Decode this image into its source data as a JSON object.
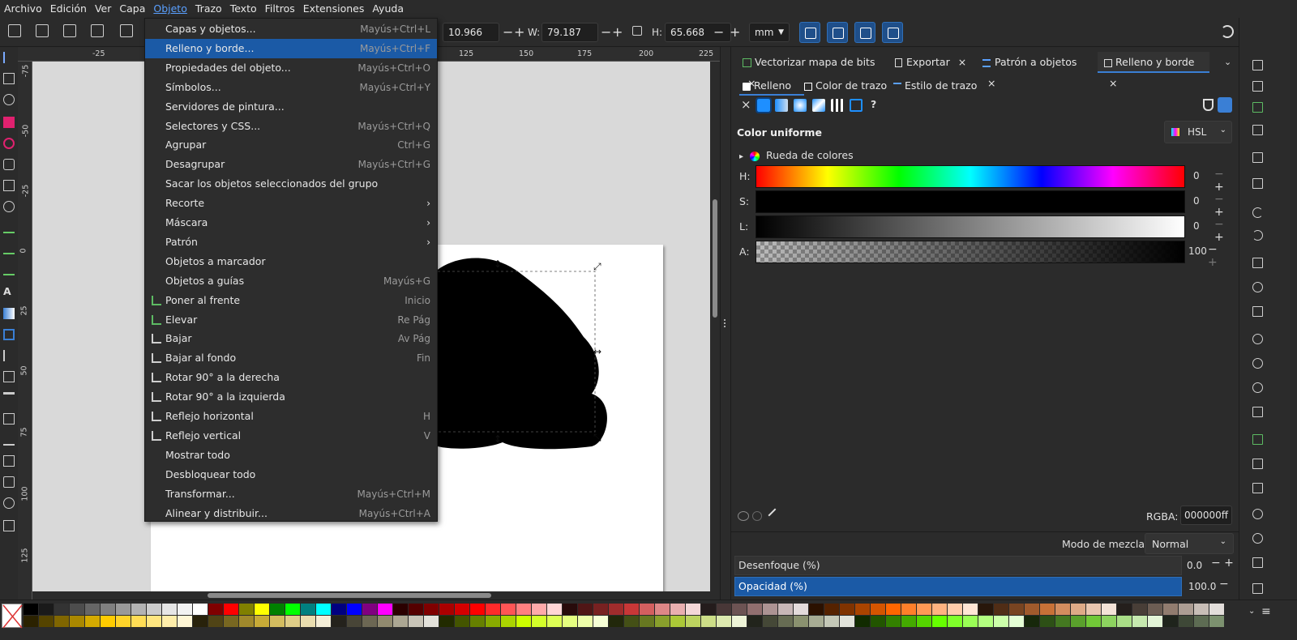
{
  "menubar": {
    "items": [
      "Archivo",
      "Edición",
      "Ver",
      "Capa",
      "Objeto",
      "Trazo",
      "Texto",
      "Filtros",
      "Extensiones",
      "Ayuda"
    ],
    "active": "Objeto"
  },
  "toolbar": {
    "x_value": "10.966",
    "w_label": "W:",
    "w_value": "79.187",
    "h_label": "H:",
    "h_value": "65.668",
    "unit": "mm",
    "plus": "+",
    "minus": "−"
  },
  "object_menu": {
    "items": [
      {
        "label": "Capas y objetos...",
        "shortcut": "Mayús+Ctrl+L"
      },
      {
        "label": "Relleno y borde...",
        "shortcut": "Mayús+Ctrl+F",
        "highlighted": true
      },
      {
        "label": "Propiedades del objeto...",
        "shortcut": "Mayús+Ctrl+O"
      },
      {
        "label": "Símbolos...",
        "shortcut": "Mayús+Ctrl+Y"
      },
      {
        "label": "Servidores de pintura...",
        "shortcut": ""
      },
      {
        "label": "Selectores y CSS...",
        "shortcut": "Mayús+Ctrl+Q"
      },
      {
        "label": "Agrupar",
        "shortcut": "Ctrl+G"
      },
      {
        "label": "Desagrupar",
        "shortcut": "Mayús+Ctrl+G"
      },
      {
        "label": "Sacar los objetos seleccionados del grupo",
        "shortcut": ""
      },
      {
        "label": "Recorte",
        "shortcut": "",
        "submenu": true
      },
      {
        "label": "Máscara",
        "shortcut": "",
        "submenu": true
      },
      {
        "label": "Patrón",
        "shortcut": "",
        "submenu": true
      },
      {
        "label": "Objetos a marcador",
        "shortcut": ""
      },
      {
        "label": "Objetos a guías",
        "shortcut": "Mayús+G"
      },
      {
        "label": "Poner al frente",
        "shortcut": "Inicio",
        "icon": "raise-to-top-icon"
      },
      {
        "label": "Elevar",
        "shortcut": "Re Pág",
        "icon": "raise-icon"
      },
      {
        "label": "Bajar",
        "shortcut": "Av Pág",
        "icon": "lower-icon"
      },
      {
        "label": "Bajar al fondo",
        "shortcut": "Fin",
        "icon": "lower-to-bottom-icon"
      },
      {
        "label": "Rotar 90° a la derecha",
        "shortcut": "",
        "icon": "rotate-cw-icon"
      },
      {
        "label": "Rotar 90° a la izquierda",
        "shortcut": "",
        "icon": "rotate-ccw-icon"
      },
      {
        "label": "Reflejo horizontal",
        "shortcut": "H",
        "icon": "flip-horizontal-icon"
      },
      {
        "label": "Reflejo vertical",
        "shortcut": "V",
        "icon": "flip-vertical-icon"
      },
      {
        "label": "Mostrar todo",
        "shortcut": ""
      },
      {
        "label": "Desbloquear todo",
        "shortcut": ""
      },
      {
        "label": "Transformar...",
        "shortcut": "Mayús+Ctrl+M"
      },
      {
        "label": "Alinear y distribuir...",
        "shortcut": "Mayús+Ctrl+A"
      }
    ],
    "submenu_arrow": "›"
  },
  "rulers": {
    "top_labels": [
      "-25",
      "125",
      "150",
      "175",
      "200",
      "225"
    ],
    "left_labels": [
      "-75",
      "-50",
      "-25",
      "0",
      "25",
      "50",
      "75",
      "100",
      "125"
    ]
  },
  "dock": {
    "tabs": [
      {
        "label": "Vectorizar mapa de bits",
        "close": "×"
      },
      {
        "label": "Exportar",
        "close": "×"
      },
      {
        "label": "Patrón a objetos",
        "close": "×"
      },
      {
        "label": "Relleno y borde",
        "close": "×",
        "active": true
      }
    ],
    "subtabs": [
      "Relleno",
      "Color de trazo",
      "Estilo de trazo"
    ],
    "help_glyph": "?",
    "none_glyph": "×",
    "section_title": "Color uniforme",
    "color_mode": "HSL",
    "wheel_label": "Rueda de colores",
    "sliders": [
      {
        "label": "H:",
        "value": "0"
      },
      {
        "label": "S:",
        "value": "0"
      },
      {
        "label": "L:",
        "value": "0"
      },
      {
        "label": "A:",
        "value": "100"
      }
    ],
    "rgba_label": "RGBA:",
    "rgba_value": "000000ff",
    "blend_label": "Modo de mezcla:",
    "blend_value": "Normal",
    "blur_label": "Desenfoque (%)",
    "blur_value": "0.0",
    "opacity_label": "Opacidad (%)",
    "opacity_value": "100.0"
  },
  "colors": {
    "accent": "#1b5aa6",
    "menu_bg": "#2d2d2d",
    "canvas_bg": "#d9d9d9",
    "shape": "#000000"
  },
  "palette": [
    "#000000",
    "#1a1a1a",
    "#333333",
    "#4d4d4d",
    "#666666",
    "#808080",
    "#999999",
    "#b3b3b3",
    "#cccccc",
    "#e6e6e6",
    "#f2f2f2",
    "#ffffff",
    "#800000",
    "#ff0000",
    "#808000",
    "#ffff00",
    "#008000",
    "#00ff00",
    "#008080",
    "#00ffff",
    "#000080",
    "#0000ff",
    "#800080",
    "#ff00ff",
    "#2b0000",
    "#550000",
    "#800000",
    "#aa0000",
    "#d40000",
    "#ff0000",
    "#ff2a2a",
    "#ff5555",
    "#ff8080",
    "#ffaaaa",
    "#ffd5d5",
    "#280b0b",
    "#501616",
    "#782121",
    "#a02c2c",
    "#c83737",
    "#d35f5f",
    "#de8787",
    "#e9afaf",
    "#f4d7d7",
    "#241c1c",
    "#483737",
    "#6c5353",
    "#916f6f",
    "#ac9393",
    "#c8b7b7",
    "#e3dbdb",
    "#2b1100",
    "#552200",
    "#803300",
    "#aa4400",
    "#d45500",
    "#ff6600",
    "#ff7f2a",
    "#ff9955",
    "#ffb380",
    "#ffccaa",
    "#ffe6d5",
    "#28170b",
    "#502d16",
    "#784421",
    "#a05a2c",
    "#c87137",
    "#d38d5f",
    "#deaa87",
    "#e9c6af",
    "#f4e3d7",
    "#241f1c",
    "#483e37",
    "#6c5d53",
    "#917c6f",
    "#ac9d93",
    "#c8beb7",
    "#e3dedb",
    "#2b2200",
    "#554400",
    "#806600",
    "#aa8800",
    "#d4aa00",
    "#ffcc00",
    "#ffd42a",
    "#ffdd55",
    "#ffe680",
    "#ffeeaa",
    "#fff6d5",
    "#28220b",
    "#504416",
    "#786721",
    "#a0892c",
    "#c8ab37",
    "#d3bc5f",
    "#decd87",
    "#e9ddaf",
    "#f4eed7",
    "#24221c",
    "#484537",
    "#6c6753",
    "#918a6f",
    "#aca793",
    "#c8c4b7",
    "#e3e2db",
    "#222b00",
    "#445500",
    "#668000",
    "#88aa00",
    "#aad400",
    "#ccff00",
    "#d4ff2a",
    "#ddff55",
    "#e5ff80",
    "#eeffaa",
    "#f6ffd5",
    "#22280b",
    "#445016",
    "#677821",
    "#89a02c",
    "#abc837",
    "#bcd35f",
    "#cdde87",
    "#dde9af",
    "#eef4d7",
    "#22241c",
    "#454837",
    "#676c53",
    "#8a916f",
    "#a7ac93",
    "#c4c8b7",
    "#e2e3db",
    "#112b00",
    "#225500",
    "#338000",
    "#44aa00",
    "#55d400",
    "#66ff00",
    "#7fff2a",
    "#99ff55",
    "#b3ff80",
    "#ccffaa",
    "#e5ffd5",
    "#17280b",
    "#2d5016",
    "#447821",
    "#5aa02c",
    "#71c837",
    "#8dd35f",
    "#aade87",
    "#c6e9af",
    "#e3f4d7",
    "#1f241c",
    "#3e4837",
    "#5d6c53",
    "#7c916f",
    "#9dac93",
    "#bec8b7",
    "#dee3db",
    "#002b00",
    "#005500",
    "#008000",
    "#00aa00"
  ]
}
